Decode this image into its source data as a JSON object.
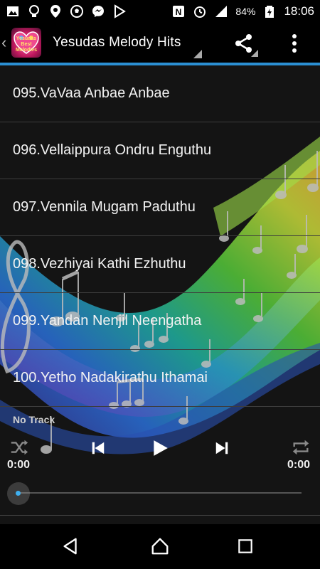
{
  "status_bar": {
    "left_icons": [
      "image-icon",
      "lightbulb-icon",
      "location-icon",
      "soccer-icon",
      "messenger-icon",
      "play-store-icon"
    ],
    "right_icons": [
      "nfc-icon",
      "alarm-icon",
      "signal-icon"
    ],
    "battery_percent": "84%",
    "time": "18:06"
  },
  "app_bar": {
    "logo_text": "Yesudas Best Melodies",
    "title": "Yesudas Melody Hits"
  },
  "tracks": [
    "095.VaVaa Anbae Anbae",
    "096.Vellaippura Ondru Enguthu",
    "097.Vennila Mugam Paduthu",
    "098.Vezhiyai Kathi Ezhuthu",
    "099.Yandan Nenjil Neengatha",
    "100.Yetho Nadakirathu Ithamai"
  ],
  "player": {
    "now_playing": "No Track",
    "elapsed": "0:00",
    "duration": "0:00",
    "progress": 0
  },
  "colors": {
    "accent": "#2b8fd3",
    "seek_thumb": "#3fb0f0"
  }
}
